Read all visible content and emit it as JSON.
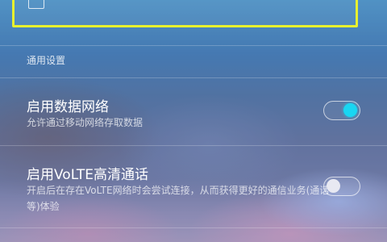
{
  "colors": {
    "highlight_border": "#e8f12e",
    "toggle_on_knob": "#19d6f2",
    "toggle_off_knob": "#e8e9f2"
  },
  "top_card": {
    "title": "···"
  },
  "section": {
    "header": "通用设置"
  },
  "settings": [
    {
      "title": "启用数据网络",
      "description": "允许通过移动网络存取数据",
      "enabled": true
    },
    {
      "title": "启用VoLTE高清通话",
      "description": "开启后在存在VoLTE网络时会尝试连接，从而获得更好的通信业务(通话等)体验",
      "enabled": false
    }
  ]
}
